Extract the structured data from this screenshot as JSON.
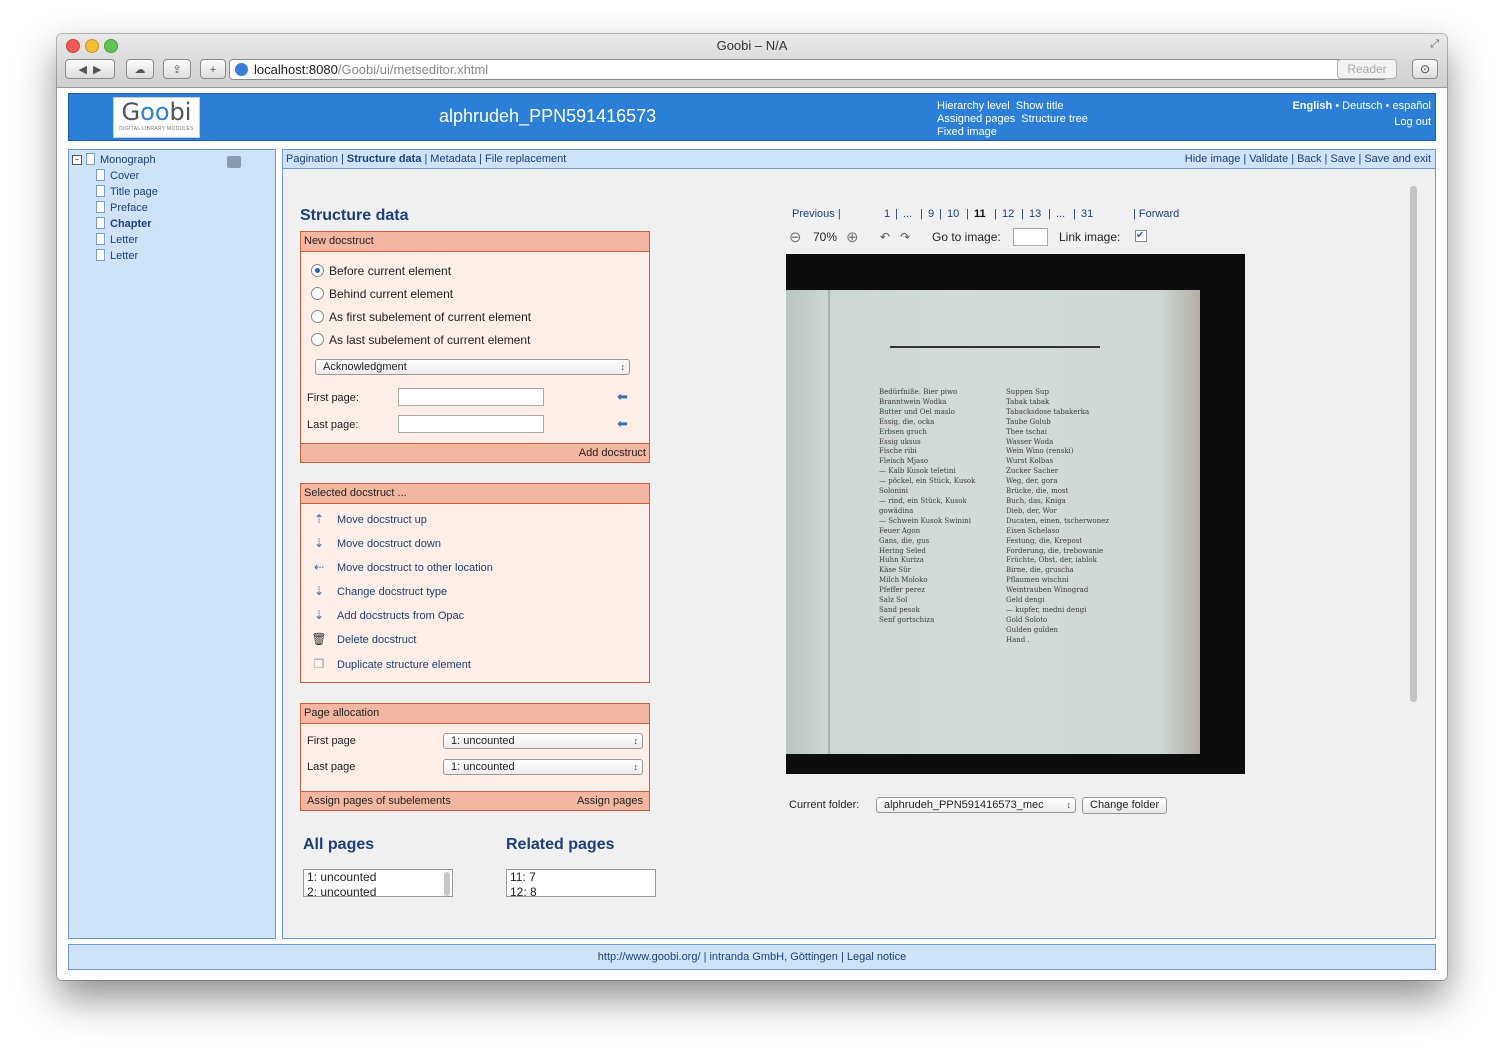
{
  "window": {
    "title": "Goobi – N/A",
    "url_host": "localhost:8080",
    "url_path": "/Goobi/ui/metseditor.xhtml",
    "reader_label": "Reader"
  },
  "header": {
    "logo_text_1": "G",
    "logo_text_2": "oo",
    "logo_text_3": "bi",
    "logo_sub": "DIGITAL LIBRARY MODULES",
    "title": "alphrudeh_PPN591416573",
    "links": [
      "Hierarchy level",
      "Show title",
      "Assigned pages",
      "Structure tree",
      "Fixed image"
    ],
    "lang_active": "English",
    "lang_others": "• Deutsch • español",
    "logout": "Log out"
  },
  "tree": {
    "root": "Monograph",
    "children": [
      "Cover",
      "Title page",
      "Preface",
      "Chapter",
      "Letter",
      "Letter"
    ]
  },
  "tabs": {
    "left": [
      "Pagination",
      "Structure data",
      "Metadata",
      "File replacement"
    ],
    "right": [
      "Hide image",
      "Validate",
      "Back",
      "Save",
      "Save and exit"
    ]
  },
  "structure": {
    "title": "Structure data",
    "new_docstruct": {
      "header": "New docstruct",
      "options": [
        "Before current element",
        "Behind current element",
        "As first subelement of current element",
        "As last subelement of current element"
      ],
      "type_value": "Acknowledgment",
      "first_page_label": "First page:",
      "last_page_label": "Last page:",
      "add_label": "Add docstruct"
    },
    "selected_docstruct": {
      "header": "Selected docstruct ...",
      "actions": [
        "Move docstruct up",
        "Move docstruct down",
        "Move docstruct to other location",
        "Change docstruct type",
        "Add docstructs from Opac",
        "Delete docstruct",
        "Duplicate structure element"
      ]
    },
    "page_allocation": {
      "header": "Page allocation",
      "first_label": "First page",
      "first_value": "1: uncounted",
      "last_label": "Last page",
      "last_value": "1: uncounted",
      "assign_sub": "Assign pages of subelements",
      "assign": "Assign pages"
    },
    "all_pages": {
      "title": "All pages",
      "items": [
        "1: uncounted",
        "2: uncounted"
      ]
    },
    "related_pages": {
      "title": "Related pages",
      "items": [
        "11: 7",
        "12: 8"
      ]
    }
  },
  "viewer": {
    "previous": "Previous |",
    "pages": [
      "1",
      "|",
      "...",
      "|",
      "9",
      "|",
      "10",
      "|",
      "11",
      "|",
      "12",
      "|",
      "13",
      "|",
      "...",
      "|",
      "31"
    ],
    "current_page": "11",
    "forward": "| Forward",
    "zoom": "70%",
    "goto_label": "Go to image:",
    "link_label": "Link image:",
    "current_folder_label": "Current folder:",
    "folder_value": "alphrudeh_PPN591416573_mec",
    "change_folder": "Change folder",
    "scan_left_col": [
      "Bedürfniße. Bier piwo",
      "Branntwein Wodka",
      "Butter und Oel maslo",
      "Essig, die, ocka",
      "Erbsen groch",
      "Essig uksus",
      "Fische ribi",
      "Fleisch Mjaso",
      "— Kalb Kusok teletini",
      "— pöckel, ein Stück, Kusok",
      "Solonini",
      "— rind, ein Stück, Kusok",
      "gowädina",
      "— Schwein Kusok Swinini",
      "Feuer Agon",
      "Gans, die, gus",
      "Hering Seled",
      "Huhn Kuriza",
      "Käse Sür",
      "Milch Moloko",
      "Pfeffer perez",
      "Salz Sol",
      "Sand pesok",
      "Senf gortschiza"
    ],
    "scan_right_col": [
      "Suppen Sup",
      "Tabak tabak",
      "Tabacksdose tabakerka",
      "Taube Golub",
      "Thee tschai",
      "Wasser Woda",
      "Wein Wino (renski)",
      "Wurst Kolbas",
      "Zucker Sacher",
      "Weg, der, gora",
      "Brücke, die, most",
      "Buch, das, Kniga",
      "Dieb, der, Wor",
      "Ducaten, einen, tscherwonez",
      "Eisen Schelaso",
      "Festung, die, Krepost",
      "Forderung, die, trebowanie",
      "Früchte, Obst, der, iablok",
      "Birne, die, gruscha",
      "Pflaumen wischni",
      "Weintrauben Winograd",
      "Geld dengi",
      "— kupfer, medni dengi",
      "Gold Soloto",
      "Gulden gulden",
      "Hand ."
    ]
  },
  "footer": {
    "text": "http://www.goobi.org/ | intranda GmbH, Göttingen | Legal notice"
  }
}
